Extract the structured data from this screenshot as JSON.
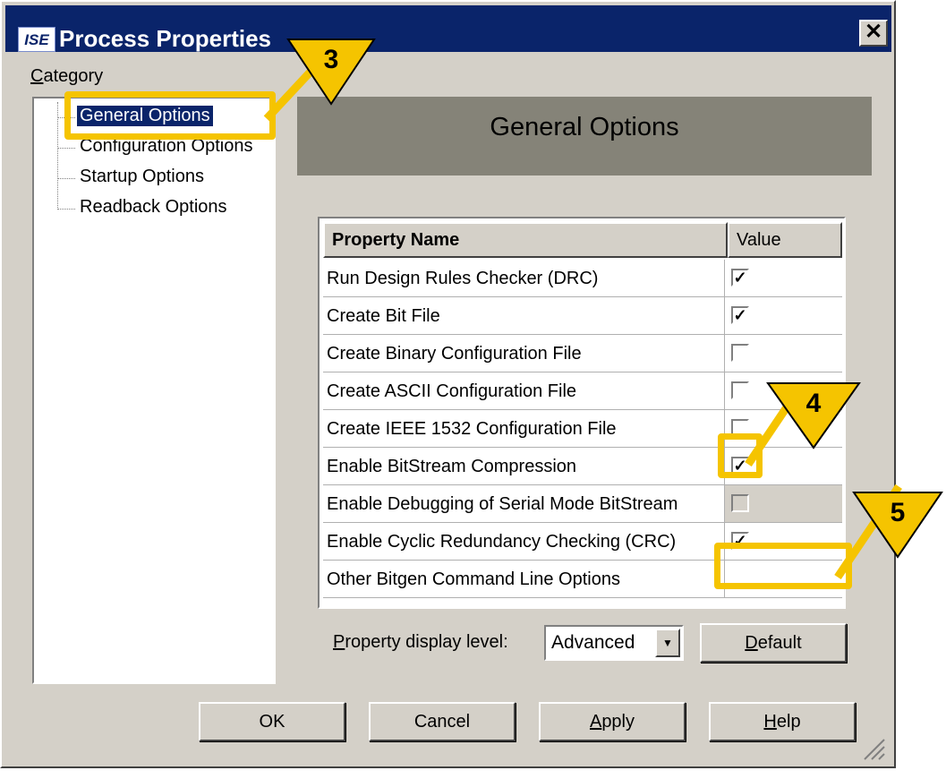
{
  "window": {
    "title": "Process Properties",
    "app_icon_text": "ISE",
    "close_glyph": "✕"
  },
  "category_label": "Category",
  "tree": {
    "items": [
      {
        "label": "General Options",
        "selected": true
      },
      {
        "label": "Configuration Options",
        "selected": false
      },
      {
        "label": "Startup Options",
        "selected": false
      },
      {
        "label": "Readback Options",
        "selected": false
      }
    ]
  },
  "header": {
    "title": "General Options",
    "panel_color": "#858378"
  },
  "grid": {
    "columns": [
      "Property Name",
      "Value"
    ],
    "rows": [
      {
        "name": "Run Design Rules Checker (DRC)",
        "checked": true,
        "disabled": false
      },
      {
        "name": "Create Bit File",
        "checked": true,
        "disabled": false
      },
      {
        "name": "Create Binary Configuration File",
        "checked": false,
        "disabled": false
      },
      {
        "name": "Create ASCII Configuration File",
        "checked": false,
        "disabled": false
      },
      {
        "name": "Create IEEE 1532 Configuration File",
        "checked": false,
        "disabled": false
      },
      {
        "name": "Enable BitStream Compression",
        "checked": true,
        "disabled": false
      },
      {
        "name": "Enable Debugging of Serial Mode BitStream",
        "checked": false,
        "disabled": true
      },
      {
        "name": "Enable Cyclic Redundancy Checking (CRC)",
        "checked": true,
        "disabled": false
      },
      {
        "name": "Other Bitgen Command Line Options",
        "checked": null,
        "disabled": false,
        "text_value": ""
      }
    ]
  },
  "display_level": {
    "label": "Property display level:",
    "value": "Advanced"
  },
  "buttons": {
    "default": "Default",
    "ok": "OK",
    "cancel": "Cancel",
    "apply": "Apply",
    "help": "Help"
  },
  "callouts": [
    {
      "number": "3"
    },
    {
      "number": "4"
    },
    {
      "number": "5"
    }
  ],
  "colors": {
    "title_bar": "#0a246a",
    "dialog_face": "#d4d0c8",
    "callout_yellow": "#f5c400",
    "selection": "#0a246a"
  }
}
